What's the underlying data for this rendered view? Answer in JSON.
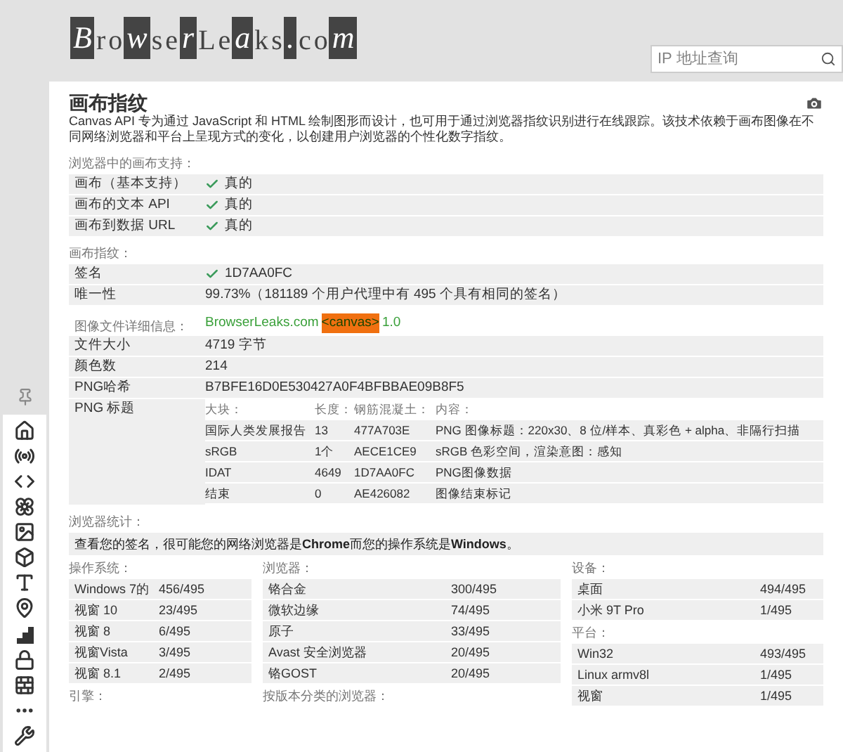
{
  "header": {
    "logo": "BrowserLeaks.com",
    "search": {
      "placeholder": "IP 地址查询"
    }
  },
  "page": {
    "title": "画布指纹",
    "description": "Canvas API 专为通过 JavaScript 和 HTML 绘制图形而设计，也可用于通过浏览器指纹识别进行在线跟踪。该技术依赖于画布图像在不同网络浏览器和平台上呈现方式的变化，以创建用户浏览器的个性化数字指纹。"
  },
  "support": {
    "label": "浏览器中的画布支持：",
    "rows": [
      {
        "label": "画布（基本支持）",
        "value": "真的",
        "checked": true
      },
      {
        "label": "画布的文本 API",
        "value": "真的",
        "checked": true
      },
      {
        "label": "画布到数据 URL",
        "value": "真的",
        "checked": true
      }
    ]
  },
  "fingerprint": {
    "label": "画布指纹：",
    "rows": [
      {
        "label": "签名",
        "value": "1D7AA0FC",
        "checked": true
      },
      {
        "label": "唯一性",
        "value": "99.73%（181189 个用户代理中有 495 个具有相同的签名）",
        "checked": false
      }
    ]
  },
  "image_info": {
    "label": "图像文件详细信息：",
    "canvas_image": {
      "site": "BrowserLeaks.com",
      "tag": "<canvas>",
      "version": "1.0"
    },
    "rows": [
      {
        "label": "文件大小",
        "value": "4719 字节"
      },
      {
        "label": "颜色数",
        "value": "214"
      },
      {
        "label": "PNG哈希",
        "value": "B7BFE16D0E530427A0F4BFBBAE09B8F5"
      }
    ],
    "png_headers": {
      "label": "PNG 标题",
      "columns": [
        "大块：",
        "长度：",
        "钢筋混凝土：",
        "内容："
      ],
      "rows": [
        [
          "国际人类发展报告",
          "13",
          "477A703E",
          "PNG 图像标题：220x30、8 位/样本、真彩色 + alpha、非隔行扫描"
        ],
        [
          "sRGB",
          "1个",
          "AECE1CE9",
          "sRGB 色彩空间，渲染意图：感知"
        ],
        [
          "IDAT",
          "4649",
          "1D7AA0FC",
          "PNG图像数据"
        ],
        [
          "结束",
          "0",
          "AE426082",
          "图像结束标记"
        ]
      ]
    }
  },
  "stats": {
    "label": "浏览器统计：",
    "summary": "查看您的签名，很可能您的网络浏览器是**Chrome**而您的操作系统是**Windows**。",
    "columns": [
      {
        "groups": [
          {
            "label": "操作系统：",
            "rows": [
              {
                "name": "Windows 7的",
                "count": "456/495"
              },
              {
                "name": "视窗 10",
                "count": "23/495"
              },
              {
                "name": "视窗 8",
                "count": "6/495"
              },
              {
                "name": "视窗Vista",
                "count": "3/495"
              },
              {
                "name": "视窗 8.1",
                "count": "2/495"
              }
            ]
          },
          {
            "label": "引擎："
          }
        ]
      },
      {
        "groups": [
          {
            "label": "浏览器：",
            "rows": [
              {
                "name": "铬合金",
                "count": "300/495"
              },
              {
                "name": "微软边缘",
                "count": "74/495"
              },
              {
                "name": "原子",
                "count": "33/495"
              },
              {
                "name": "Avast 安全浏览器",
                "count": "20/495"
              },
              {
                "name": "铬GOST",
                "count": "20/495"
              }
            ]
          },
          {
            "label": "按版本分类的浏览器："
          }
        ]
      },
      {
        "groups": [
          {
            "label": "设备：",
            "rows": [
              {
                "name": "桌面",
                "count": "494/495"
              },
              {
                "name": "小米 9T Pro",
                "count": "1/495"
              }
            ]
          },
          {
            "label": "平台：",
            "rows": [
              {
                "name": "Win32",
                "count": "493/495"
              },
              {
                "name": "Linux armv8l",
                "count": "1/495"
              },
              {
                "name": "视窗",
                "count": "1/495"
              }
            ]
          }
        ]
      }
    ]
  }
}
